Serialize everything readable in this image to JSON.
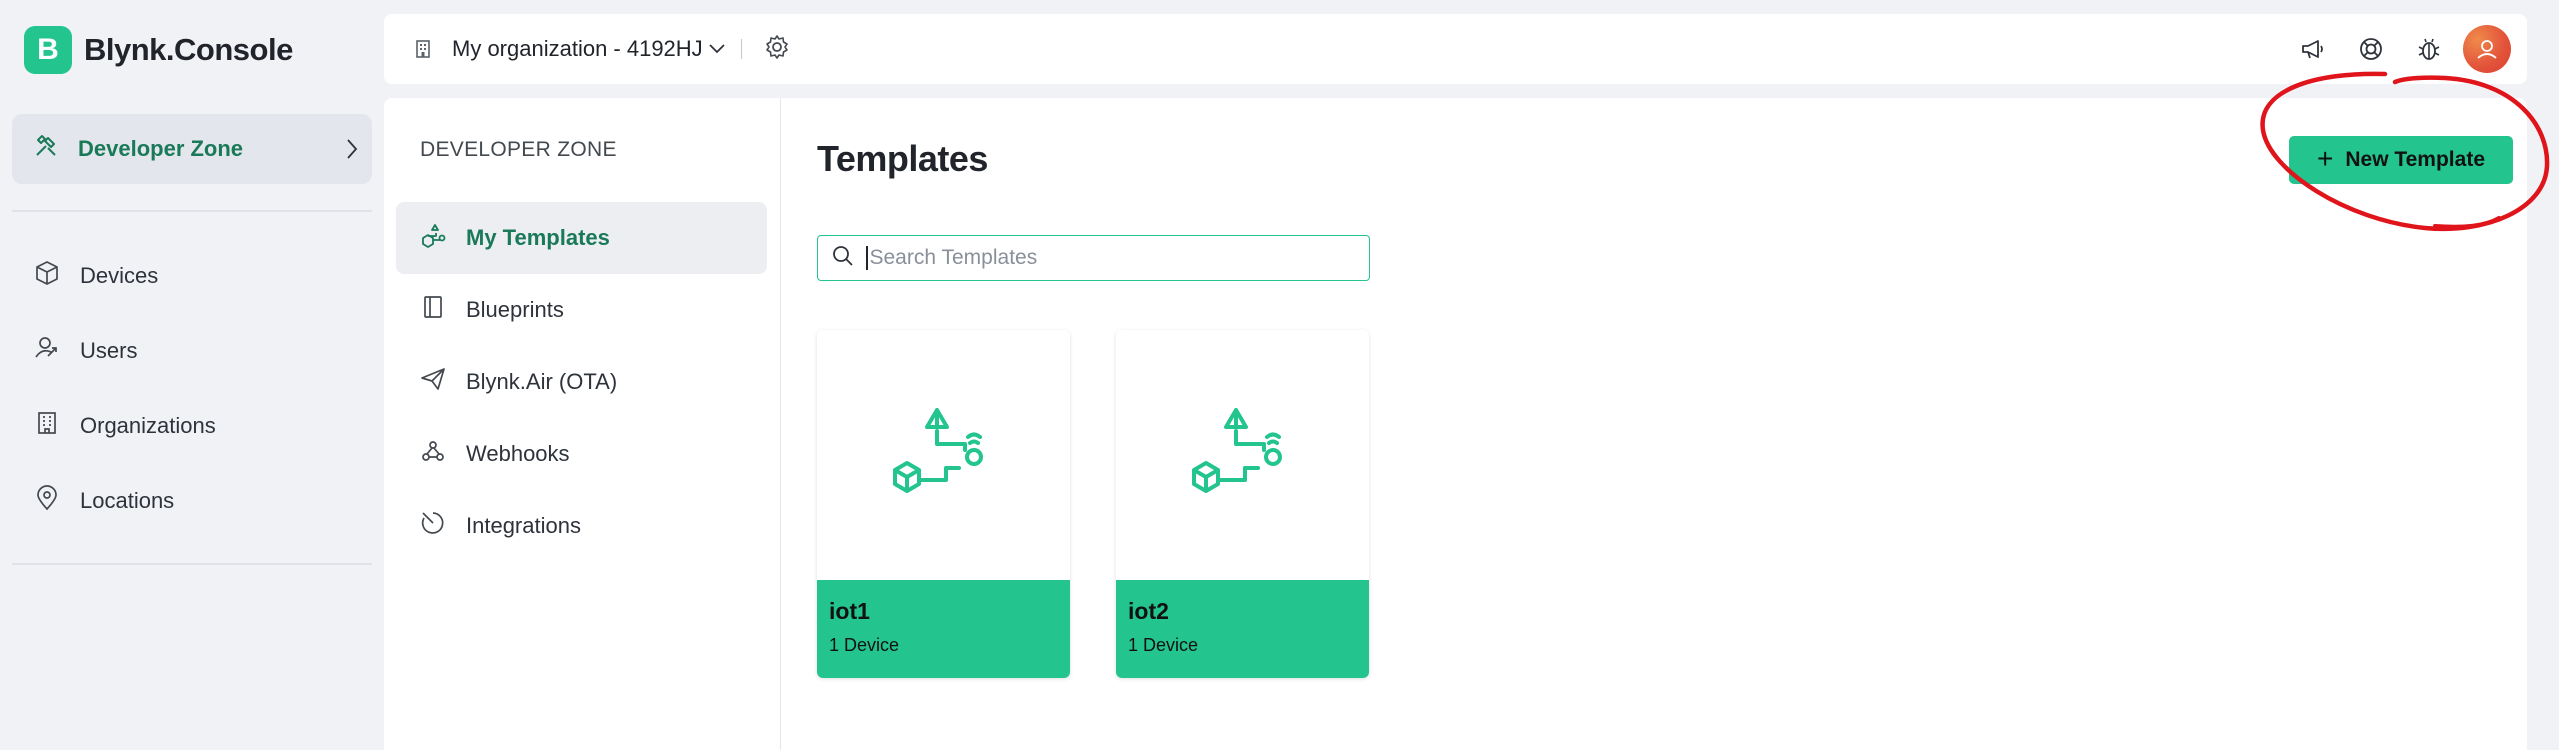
{
  "app": {
    "logo_letter": "B",
    "name": "Blynk.Console"
  },
  "topbar": {
    "org_name": "My organization - 4192HJ",
    "icons": [
      "megaphone-icon",
      "lifebuoy-icon",
      "bug-icon",
      "user-avatar"
    ]
  },
  "sidebar": {
    "developer_zone": "Developer Zone",
    "items": [
      {
        "label": "Devices",
        "icon": "cube-icon"
      },
      {
        "label": "Users",
        "icon": "users-icon"
      },
      {
        "label": "Organizations",
        "icon": "building-icon"
      },
      {
        "label": "Locations",
        "icon": "pin-icon"
      }
    ]
  },
  "subnav": {
    "title": "DEVELOPER ZONE",
    "items": [
      {
        "label": "My Templates",
        "icon": "templates-icon",
        "active": true
      },
      {
        "label": "Blueprints",
        "icon": "book-icon"
      },
      {
        "label": "Blynk.Air (OTA)",
        "icon": "paper-plane-icon"
      },
      {
        "label": "Webhooks",
        "icon": "webhook-icon"
      },
      {
        "label": "Integrations",
        "icon": "integrations-icon"
      }
    ]
  },
  "main": {
    "title": "Templates",
    "new_button": "New Template",
    "search_placeholder": "Search Templates",
    "templates": [
      {
        "name": "iot1",
        "devices": "1 Device"
      },
      {
        "name": "iot2",
        "devices": "1 Device"
      }
    ]
  },
  "colors": {
    "accent": "#23c48e",
    "accent_dark": "#1a7a58",
    "annotation": "#e0151b"
  }
}
